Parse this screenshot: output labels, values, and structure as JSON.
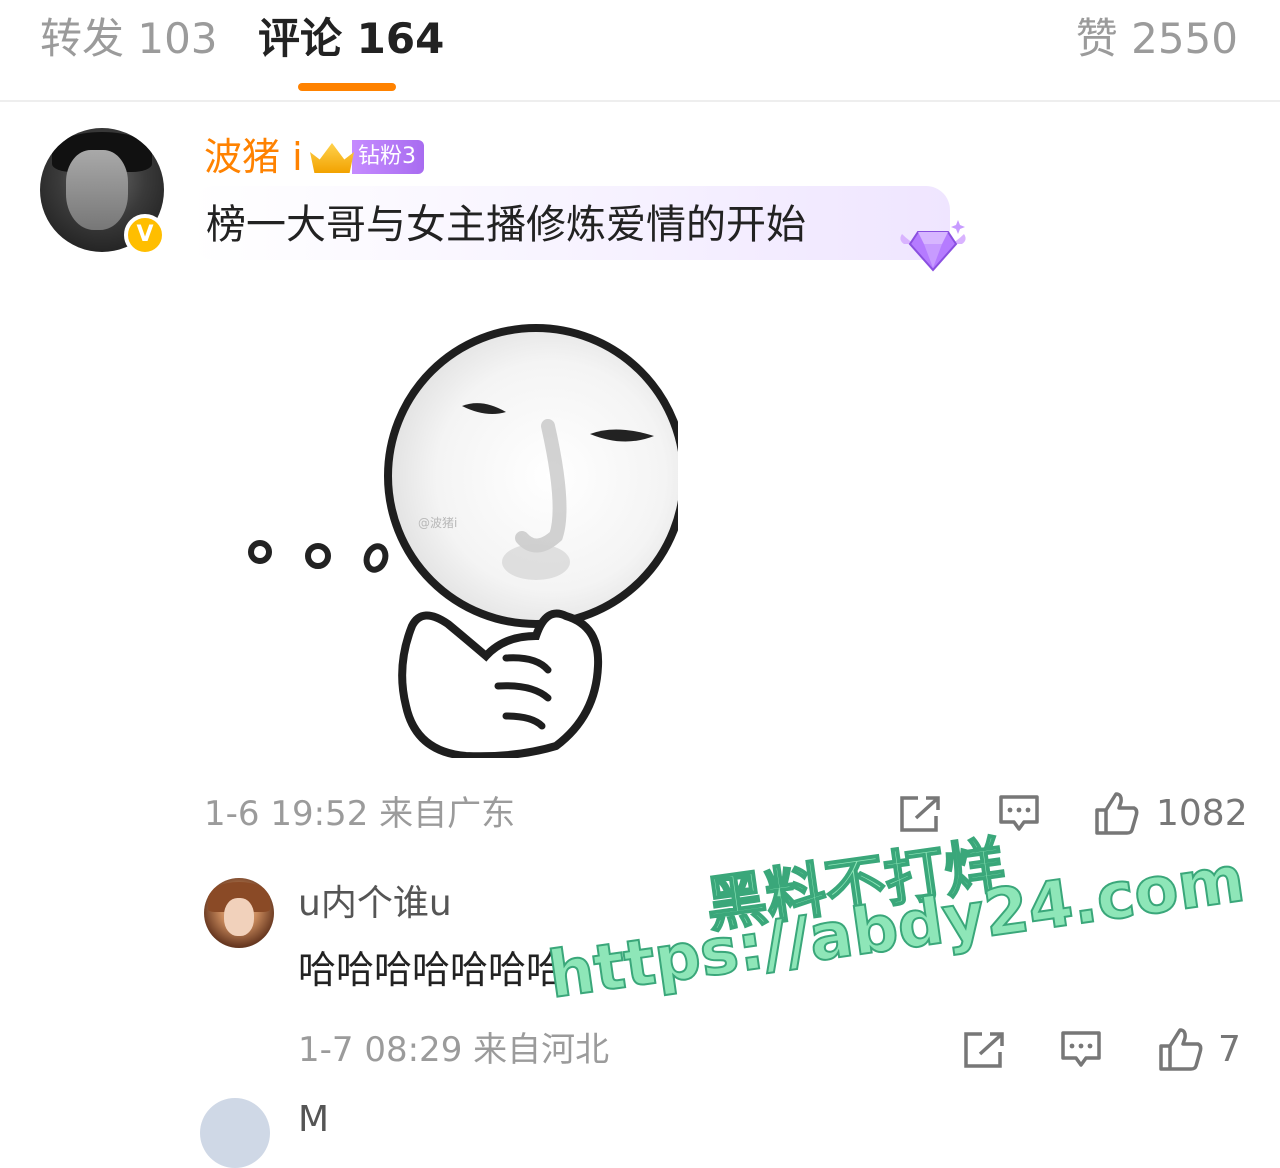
{
  "tabs": {
    "repost_label": "转发 103",
    "comment_label": "评论 164",
    "like_label": "赞 2550"
  },
  "main_comment": {
    "username": "波猪 i",
    "fan_badge": "钻粉3",
    "text": "榜一大哥与女主播修炼爱情的开始",
    "verify_mark": "V",
    "sticker_watermark": "@波猪i",
    "time_location": "1-6 19:52  来自广东",
    "like_count": "1082"
  },
  "reply": {
    "username": "u内个谁u",
    "text": "哈哈哈哈哈哈哈",
    "time_location": "1-7 08:29  来自河北",
    "like_count": "7"
  },
  "next_comment": {
    "username_partial": "M"
  },
  "watermark": {
    "cn": "黑料不打烊",
    "url": "https://abdy24.com"
  },
  "colors": {
    "accent": "#ff8200",
    "muted": "#9b9b9b",
    "verify": "#ffbe00",
    "fan_badge": "#a86cf0",
    "watermark": "#8ee6b8"
  },
  "icons": [
    "share-icon",
    "comment-icon",
    "like-icon",
    "diamond-icon",
    "crown-icon",
    "verified-icon"
  ]
}
